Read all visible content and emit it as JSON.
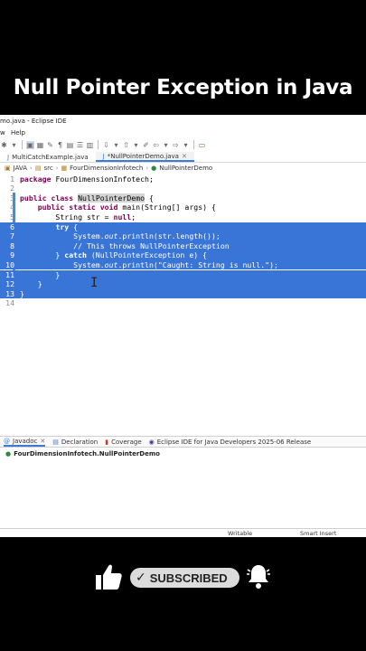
{
  "banner": {
    "title": "Null Pointer Exception in Java"
  },
  "window": {
    "title": "mo.java - Eclipse IDE"
  },
  "menu": {
    "items": [
      "w",
      "Help"
    ]
  },
  "tabs": [
    {
      "label": "MultiCatchExample.java",
      "active": false
    },
    {
      "label": "*NullPointerDemo.java",
      "active": true
    }
  ],
  "breadcrumb": [
    "JAVA",
    "src",
    "FourDimensionInfotech",
    "NullPointerDemo"
  ],
  "editor": {
    "lines": [
      {
        "n": "1",
        "tokens": [
          [
            "kw",
            "package"
          ],
          [
            "t",
            " FourDimensionInfotech;"
          ]
        ]
      },
      {
        "n": "2",
        "tokens": []
      },
      {
        "n": "3",
        "tokens": [
          [
            "kw",
            "public"
          ],
          [
            "t",
            " "
          ],
          [
            "kw",
            "class"
          ],
          [
            "t",
            " "
          ],
          [
            "hl",
            "NullPointerDemo"
          ],
          [
            "t",
            " {"
          ]
        ]
      },
      {
        "n": "4",
        "tokens": [
          [
            "t",
            "    "
          ],
          [
            "kw",
            "public"
          ],
          [
            "t",
            " "
          ],
          [
            "kw",
            "static"
          ],
          [
            "t",
            " "
          ],
          [
            "kw",
            "void"
          ],
          [
            "t",
            " main(String[] args) {"
          ]
        ]
      },
      {
        "n": "5",
        "tokens": [
          [
            "t",
            "        String str = "
          ],
          [
            "kw",
            "null"
          ],
          [
            "t",
            ";"
          ]
        ]
      },
      {
        "n": "6",
        "tokens": [
          [
            "t",
            "        "
          ],
          [
            "kw",
            "try"
          ],
          [
            "t",
            " {"
          ]
        ]
      },
      {
        "n": "7",
        "tokens": [
          [
            "t",
            "            System."
          ],
          [
            "it",
            "out"
          ],
          [
            "t",
            ".println(str.length());"
          ]
        ]
      },
      {
        "n": "8",
        "tokens": [
          [
            "t",
            "            // This throws NullPointerException"
          ]
        ]
      },
      {
        "n": "9",
        "tokens": [
          [
            "t",
            "        } "
          ],
          [
            "kw",
            "catch"
          ],
          [
            "t",
            " (NullPointerException e) {"
          ]
        ]
      },
      {
        "n": "10",
        "tokens": [
          [
            "t",
            "            System."
          ],
          [
            "it",
            "out"
          ],
          [
            "t",
            ".println(\"Caught: String is null.\");"
          ]
        ]
      },
      {
        "n": "11",
        "tokens": [
          [
            "t",
            "        }"
          ]
        ]
      },
      {
        "n": "12",
        "tokens": [
          [
            "t",
            "    }"
          ]
        ]
      },
      {
        "n": "13",
        "tokens": [
          [
            "t",
            "}"
          ]
        ]
      },
      {
        "n": "14",
        "tokens": []
      }
    ],
    "selected_lines": [
      6,
      13
    ]
  },
  "bottom_tabs": [
    "Javadoc",
    "Declaration",
    "Coverage",
    "Eclipse IDE for Java Developers 2025-06 Release"
  ],
  "javadoc_item": "FourDimensionInfotech.NullPointerDemo",
  "status": {
    "mode": "Writable",
    "insert": "Smart Insert"
  },
  "subscribe": {
    "label": "SUBSCRIBED",
    "check": "✓"
  },
  "colors": {
    "selection": "#3875d7",
    "keyword": "#7f0055",
    "accent": "#3b7bd9"
  }
}
